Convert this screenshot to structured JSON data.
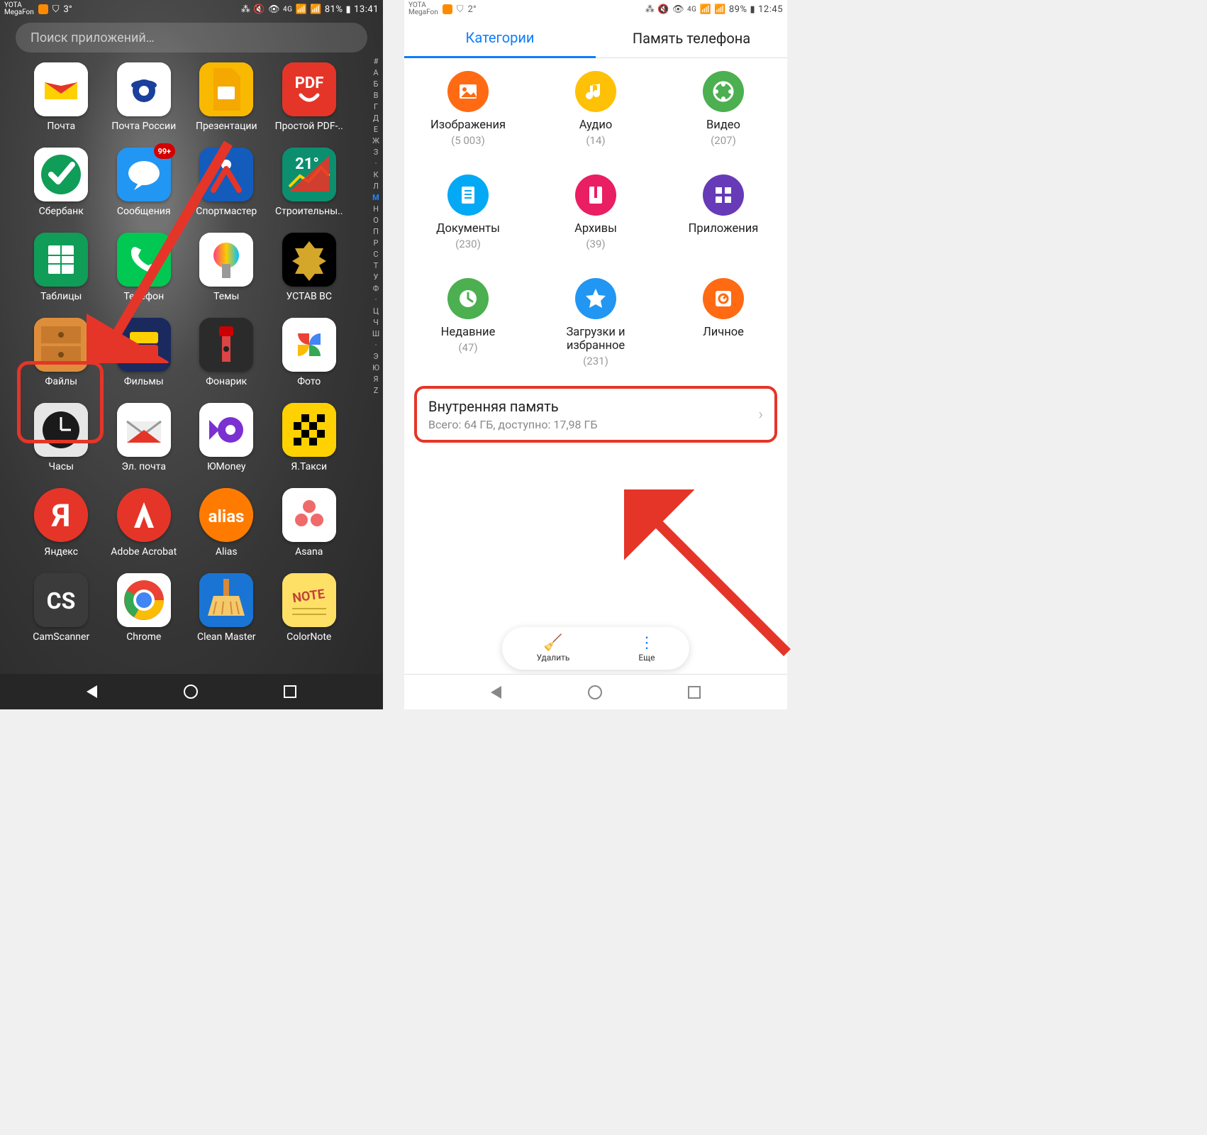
{
  "left": {
    "status": {
      "carrier1": "YOTA",
      "carrier2": "MegaFon",
      "temp": "3°",
      "battery": "81%",
      "time": "13:41",
      "icons": "⁂ ✼ ⌚ "
    },
    "search_placeholder": "Поиск приложений…",
    "alpha_index": [
      "#",
      "А",
      "Б",
      "В",
      "Г",
      "Д",
      "Е",
      "Ж",
      "З",
      "·",
      "К",
      "Л",
      "М",
      "Н",
      "О",
      "П",
      "Р",
      "С",
      "Т",
      "У",
      "Ф",
      "·",
      "Ц",
      "Ч",
      "Ш",
      "·",
      "Э",
      "Ю",
      "Я",
      "Z"
    ],
    "alpha_active": "М",
    "apps": [
      {
        "label": "Почта",
        "color": "#ffffff",
        "svg": "mail-yandex"
      },
      {
        "label": "Почта России",
        "color": "#ffffff",
        "svg": "russian-post"
      },
      {
        "label": "Презентации",
        "color": "#f9b900",
        "svg": "google-slides"
      },
      {
        "label": "Простой PDF-..",
        "color": "#e53528",
        "svg": "pdf"
      },
      {
        "label": "Сбербанк",
        "color": "#ffffff",
        "svg": "sber"
      },
      {
        "label": "Сообщения",
        "color": "#2296f3",
        "svg": "messages",
        "badge": "99+"
      },
      {
        "label": "Спортмастер",
        "color": "#135cbc",
        "svg": "sportmaster"
      },
      {
        "label": "Строительны..",
        "color": "#0b8f6f",
        "svg": "calc"
      },
      {
        "label": "Таблицы",
        "color": "#0f9d58",
        "svg": "google-sheets"
      },
      {
        "label": "Телефон",
        "color": "#00c853",
        "svg": "phone"
      },
      {
        "label": "Темы",
        "color": "#ffffff",
        "svg": "themes"
      },
      {
        "label": "УСТАВ ВС",
        "color": "#000000",
        "svg": "coat-of-arms"
      },
      {
        "label": "Файлы",
        "color": "#de8e3b",
        "svg": "files"
      },
      {
        "label": "Фильмы",
        "color": "#1a2a5e",
        "svg": "films"
      },
      {
        "label": "Фонарик",
        "color": "#2b2b2b",
        "svg": "flashlight"
      },
      {
        "label": "Фото",
        "color": "#ffffff",
        "svg": "google-photos"
      },
      {
        "label": "Часы",
        "color": "#e6e6e6",
        "svg": "clock"
      },
      {
        "label": "Эл. почта",
        "color": "#ffffff",
        "svg": "email"
      },
      {
        "label": "ЮMoney",
        "color": "#ffffff",
        "svg": "yoomoney"
      },
      {
        "label": "Я.Такси",
        "color": "#ffd100",
        "svg": "yataxi"
      },
      {
        "label": "Яндекс",
        "color": "#e53528",
        "svg": "yandex"
      },
      {
        "label": "Adobe Acrobat",
        "color": "#e53528",
        "svg": "adobe"
      },
      {
        "label": "Alias",
        "color": "#ff7b00",
        "svg": "alias"
      },
      {
        "label": "Asana",
        "color": "#ffffff",
        "svg": "asana"
      },
      {
        "label": "CamScanner",
        "color": "#3b3b3b",
        "svg": "cs"
      },
      {
        "label": "Chrome",
        "color": "#ffffff",
        "svg": "chrome"
      },
      {
        "label": "Clean Master",
        "color": "#1a74d4",
        "svg": "broom"
      },
      {
        "label": "ColorNote",
        "color": "#ffe066",
        "svg": "note"
      }
    ]
  },
  "right": {
    "status": {
      "carrier1": "YOTA",
      "carrier2": "MegaFon",
      "temp": "2°",
      "battery": "89%",
      "time": "12:45"
    },
    "tabs": {
      "categories": "Категории",
      "storage": "Память телефона"
    },
    "categories": [
      {
        "label": "Изображения",
        "count": "(5 003)",
        "color": "#ff6a13",
        "svg": "cat-images"
      },
      {
        "label": "Аудио",
        "count": "(14)",
        "color": "#ffc107",
        "svg": "cat-audio"
      },
      {
        "label": "Видео",
        "count": "(207)",
        "color": "#4caf50",
        "svg": "cat-video"
      },
      {
        "label": "Документы",
        "count": "(230)",
        "color": "#03a9f4",
        "svg": "cat-docs"
      },
      {
        "label": "Архивы",
        "count": "(39)",
        "color": "#e91e63",
        "svg": "cat-archives"
      },
      {
        "label": "Приложения",
        "count": "",
        "color": "#673ab7",
        "svg": "cat-apps"
      },
      {
        "label": "Недавние",
        "count": "(47)",
        "color": "#4caf50",
        "svg": "cat-recent"
      },
      {
        "label": "Загрузки и\nизбранное",
        "count": "(231)",
        "color": "#2196f3",
        "svg": "cat-star"
      },
      {
        "label": "Личное",
        "count": "",
        "color": "#ff6a13",
        "svg": "cat-safe"
      }
    ],
    "storage": {
      "title": "Внутренняя память",
      "subtitle": "Всего: 64 ГБ, доступно: 17,98 ГБ"
    },
    "actions": {
      "clean": "Удалить",
      "more": "Еще"
    }
  }
}
